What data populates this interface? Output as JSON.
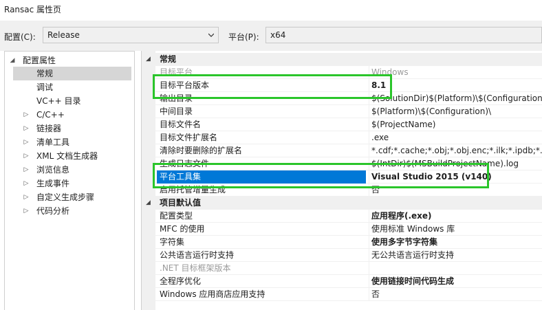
{
  "window": {
    "title": "Ransac 属性页"
  },
  "toolbar": {
    "config_label": "配置(C):",
    "config_value": "Release",
    "platform_label": "平台(P):",
    "platform_value": "x64"
  },
  "tree": {
    "root": "配置属性",
    "items": [
      {
        "label": "常规",
        "selected": true,
        "expandable": false
      },
      {
        "label": "调试",
        "expandable": false
      },
      {
        "label": "VC++ 目录",
        "expandable": false
      },
      {
        "label": "C/C++",
        "expandable": true
      },
      {
        "label": "链接器",
        "expandable": true
      },
      {
        "label": "清单工具",
        "expandable": true
      },
      {
        "label": "XML 文档生成器",
        "expandable": true
      },
      {
        "label": "浏览信息",
        "expandable": true
      },
      {
        "label": "生成事件",
        "expandable": true
      },
      {
        "label": "自定义生成步骤",
        "expandable": true
      },
      {
        "label": "代码分析",
        "expandable": true
      }
    ]
  },
  "grid": {
    "sections": [
      {
        "title": "常规",
        "rows": [
          {
            "name": "目标平台",
            "value": "Windows",
            "dim": true
          },
          {
            "name": "目标平台版本",
            "value": "8.1",
            "bold": true
          },
          {
            "name": "输出目录",
            "value": "$(SolutionDir)$(Platform)\\$(Configuration)\\"
          },
          {
            "name": "中间目录",
            "value": "$(Platform)\\$(Configuration)\\"
          },
          {
            "name": "目标文件名",
            "value": "$(ProjectName)"
          },
          {
            "name": "目标文件扩展名",
            "value": ".exe"
          },
          {
            "name": "清除时要删除的扩展名",
            "value": "*.cdf;*.cache;*.obj;*.obj.enc;*.ilk;*.ipdb;*.iobj"
          },
          {
            "name": "生成日志文件",
            "value": "$(IntDir)$(MSBuildProjectName).log"
          },
          {
            "name": "平台工具集",
            "value": "Visual Studio 2015 (v140)",
            "bold": true,
            "selected": true
          },
          {
            "name": "启用托管增量生成",
            "value": "否"
          }
        ]
      },
      {
        "title": "项目默认值",
        "rows": [
          {
            "name": "配置类型",
            "value": "应用程序(.exe)",
            "bold": true
          },
          {
            "name": "MFC 的使用",
            "value": "使用标准 Windows 库"
          },
          {
            "name": "字符集",
            "value": "使用多字节字符集",
            "bold": true
          },
          {
            "name": "公共语言运行时支持",
            "value": "无公共语言运行时支持"
          },
          {
            "name": ".NET 目标框架版本",
            "value": "",
            "dim": true
          },
          {
            "name": "全程序优化",
            "value": "使用链接时间代码生成",
            "bold": true
          },
          {
            "name": "Windows 应用商店应用支持",
            "value": "否"
          }
        ]
      }
    ]
  },
  "colors": {
    "selection": "#0078d7",
    "highlight_box": "#2ac52a"
  }
}
